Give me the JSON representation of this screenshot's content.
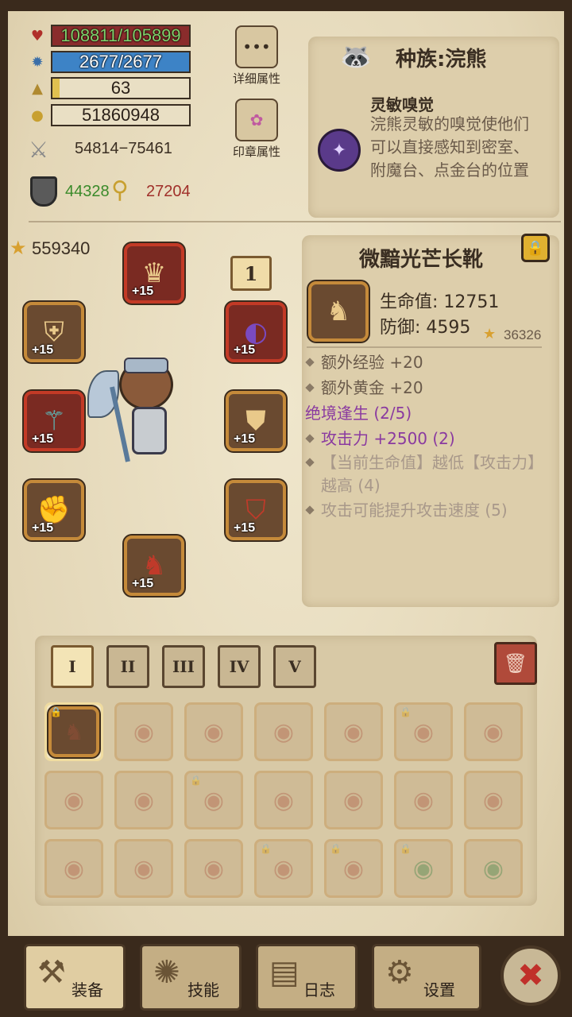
{
  "stats": {
    "hp": {
      "text": "108811/105899",
      "fill": 1.0,
      "color": "#7a2a2a"
    },
    "mp": {
      "text": "2677/2677",
      "fill": 1.0,
      "color": "#3a7ec0"
    },
    "level": {
      "text": "63",
      "fill": 0.05,
      "color": "#e0c050"
    },
    "gold": {
      "text": "51860948"
    },
    "attack": "54814−75461",
    "defense": "44328",
    "magic": "27204"
  },
  "side_buttons": {
    "detail": "详细属性",
    "seal": "印章属性"
  },
  "race": {
    "title": "种族:浣熊",
    "skill_name": "灵敏嗅觉",
    "skill_desc": "浣熊灵敏的嗅觉使他们可以直接感知到密室、附魔台、点金台的位置"
  },
  "power_score": "559340",
  "loadout_number": "1",
  "equipment": {
    "enhance_level": "+15"
  },
  "item": {
    "name": "微黯光芒长靴",
    "hp": "生命值: 12751",
    "def": "防御: 4595",
    "score": "36326",
    "bonus1": "额外经验 +20",
    "bonus2": "额外黄金 +20",
    "set_name": "绝境逢生 (2/5)",
    "set1": "攻击力 +2500 (2)",
    "set2": "【当前生命值】越低【攻击力】越高 (4)",
    "set3": "攻击可能提升攻击速度 (5)"
  },
  "tabs": [
    "I",
    "II",
    "III",
    "IV",
    "V"
  ],
  "nav": {
    "equip": "装备",
    "skills": "技能",
    "log": "日志",
    "settings": "设置"
  }
}
